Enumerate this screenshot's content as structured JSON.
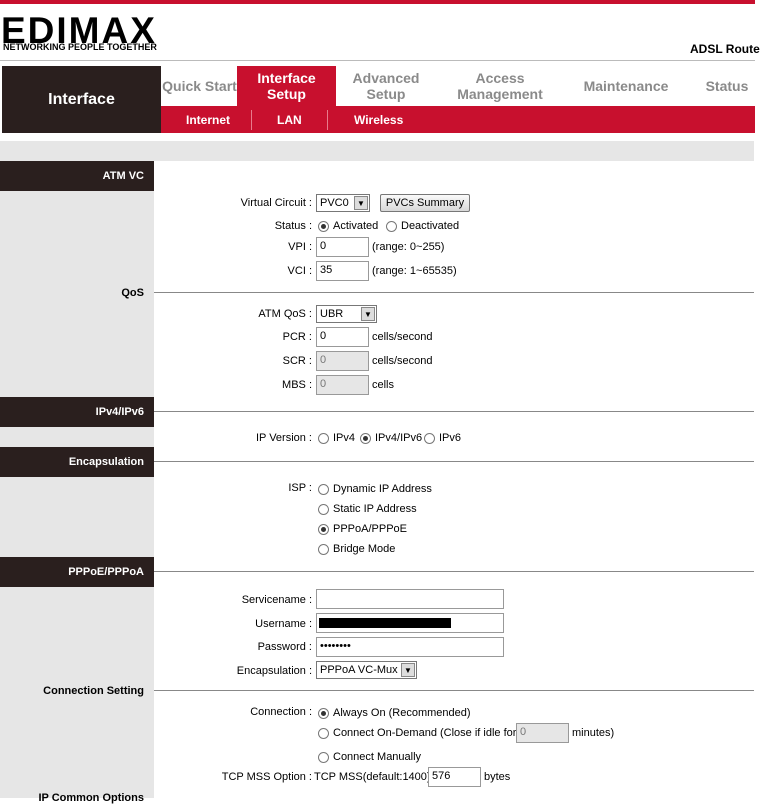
{
  "header": {
    "logo_name": "EDIMAX",
    "logo_tagline": "NETWORKING PEOPLE TOGETHER",
    "product": "ADSL Route"
  },
  "nav": {
    "section": "Interface",
    "tabs": [
      {
        "label": "Quick Start"
      },
      {
        "label": "Interface Setup",
        "active": true
      },
      {
        "label": "Advanced Setup"
      },
      {
        "label": "Access Management"
      },
      {
        "label": "Maintenance"
      },
      {
        "label": "Status"
      }
    ],
    "subtabs": [
      "Internet",
      "LAN",
      "Wireless"
    ]
  },
  "sections": {
    "atm_vc": "ATM VC",
    "qos": "QoS",
    "ipv": "IPv4/IPv6",
    "encapsulation": "Encapsulation",
    "pppoe": "PPPoE/PPPoA",
    "connection_setting": "Connection Setting",
    "ip_common": "IP Common Options"
  },
  "atm": {
    "virtual_circuit_label": "Virtual Circuit :",
    "virtual_circuit_value": "PVC0",
    "pvcs_button": "PVCs Summary",
    "status_label": "Status :",
    "status_options": [
      "Activated",
      "Deactivated"
    ],
    "vpi_label": "VPI :",
    "vpi_value": "0",
    "vpi_range": "(range: 0~255)",
    "vci_label": "VCI :",
    "vci_value": "35",
    "vci_range": "(range: 1~65535)"
  },
  "qos": {
    "atm_qos_label": "ATM QoS :",
    "atm_qos_value": "UBR",
    "pcr_label": "PCR :",
    "pcr_value": "0",
    "pcr_unit": "cells/second",
    "scr_label": "SCR :",
    "scr_value": "0",
    "scr_unit": "cells/second",
    "mbs_label": "MBS :",
    "mbs_value": "0",
    "mbs_unit": "cells"
  },
  "ip": {
    "version_label": "IP Version :",
    "options": [
      "IPv4",
      "IPv4/IPv6",
      "IPv6"
    ],
    "selected": "IPv4/IPv6"
  },
  "encap": {
    "isp_label": "ISP :",
    "options": [
      "Dynamic IP Address",
      "Static IP Address",
      "PPPoA/PPPoE",
      "Bridge Mode"
    ],
    "selected": "PPPoA/PPPoE"
  },
  "ppp": {
    "servicename_label": "Servicename :",
    "servicename_value": "",
    "username_label": "Username :",
    "password_label": "Password :",
    "password_value": "••••••••",
    "encapsulation_label": "Encapsulation :",
    "encapsulation_value": "PPPoA VC-Mux"
  },
  "connection": {
    "label": "Connection :",
    "always_on": "Always On (Recommended)",
    "on_demand": "Connect On-Demand (Close if idle for",
    "idle_value": "0",
    "minutes": "minutes)",
    "manual": "Connect Manually",
    "tcp_label": "TCP MSS Option :",
    "tcp_text": "TCP MSS(default:1400)",
    "tcp_value": "576",
    "bytes": "bytes"
  },
  "colors": {
    "accent": "#c8102e",
    "dark": "#2a1f1e",
    "panel": "#e6e6e6"
  }
}
